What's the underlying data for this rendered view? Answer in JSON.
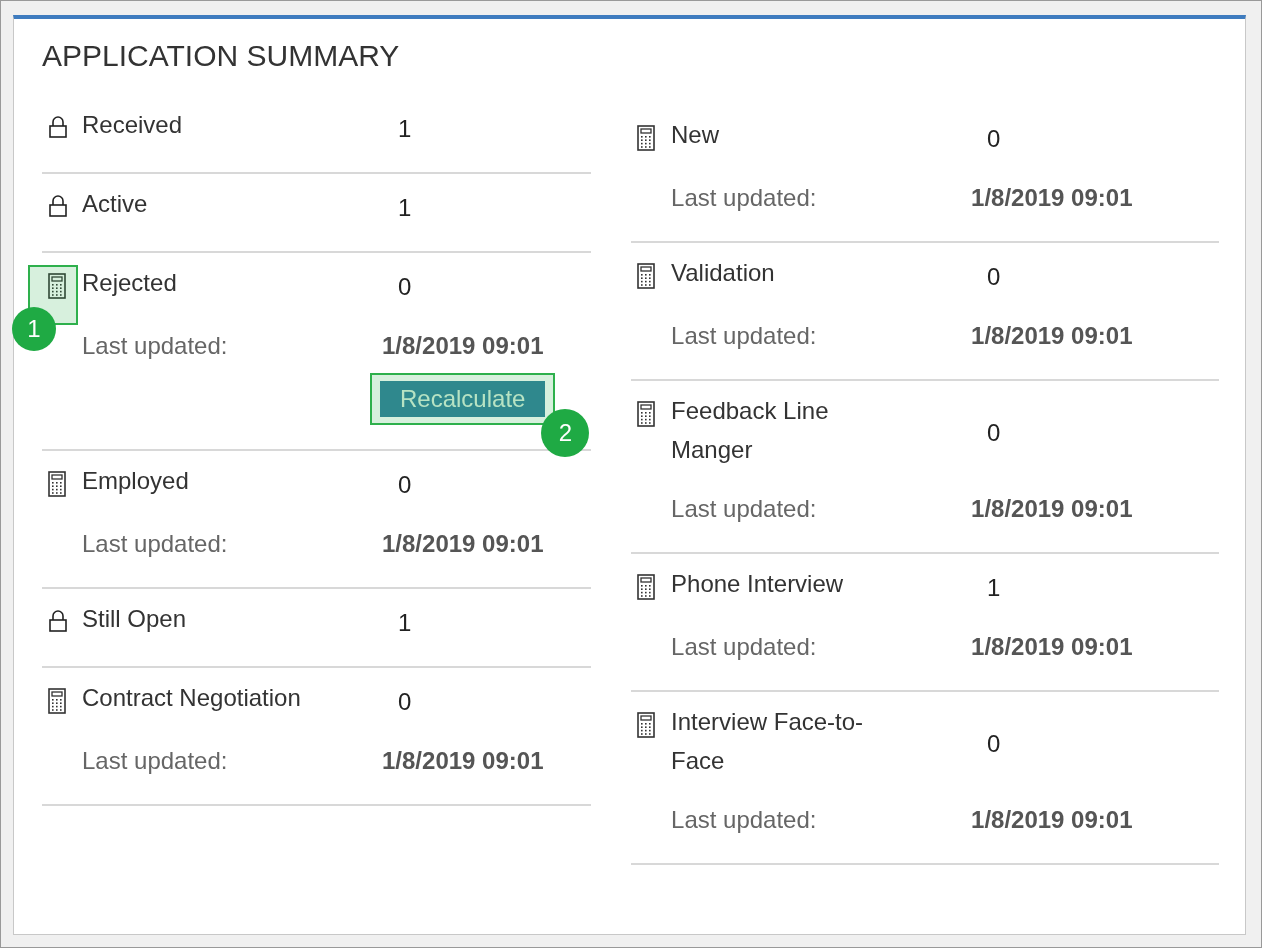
{
  "title": "APPLICATION SUMMARY",
  "columns": [
    [
      {
        "kind": "locked",
        "label": "Received",
        "value": "1"
      },
      {
        "kind": "locked",
        "label": "Active",
        "value": "1"
      },
      {
        "kind": "calculated",
        "label": "Rejected",
        "value": "0",
        "callout": "1",
        "updated_label": "Last updated:",
        "updated": "1/8/2019 09:01",
        "button": {
          "label": "Recalculate",
          "callout": "2"
        }
      },
      {
        "kind": "calculated",
        "label": "Employed",
        "value": "0",
        "updated_label": "Last updated:",
        "updated": "1/8/2019 09:01"
      },
      {
        "kind": "locked",
        "label": "Still Open",
        "value": "1"
      },
      {
        "kind": "calculated",
        "label": "Contract Negotiation",
        "value": "0",
        "updated_label": "Last updated:",
        "updated": "1/8/2019 09:01"
      }
    ],
    [
      {
        "kind": "calculated",
        "label": "New",
        "value": "0",
        "updated_label": "Last updated:",
        "updated": "1/8/2019 09:01"
      },
      {
        "kind": "calculated",
        "label": "Validation",
        "value": "0",
        "updated_label": "Last updated:",
        "updated": "1/8/2019 09:01"
      },
      {
        "kind": "calculated",
        "label": "Feedback Line Manger",
        "value": "0",
        "updated_label": "Last updated:",
        "updated": "1/8/2019 09:01"
      },
      {
        "kind": "calculated",
        "label": "Phone Interview",
        "value": "1",
        "updated_label": "Last updated:",
        "updated": "1/8/2019 09:01"
      },
      {
        "kind": "calculated",
        "label": "Interview Face-to-Face",
        "value": "0",
        "updated_label": "Last updated:",
        "updated": "1/8/2019 09:01"
      }
    ]
  ]
}
